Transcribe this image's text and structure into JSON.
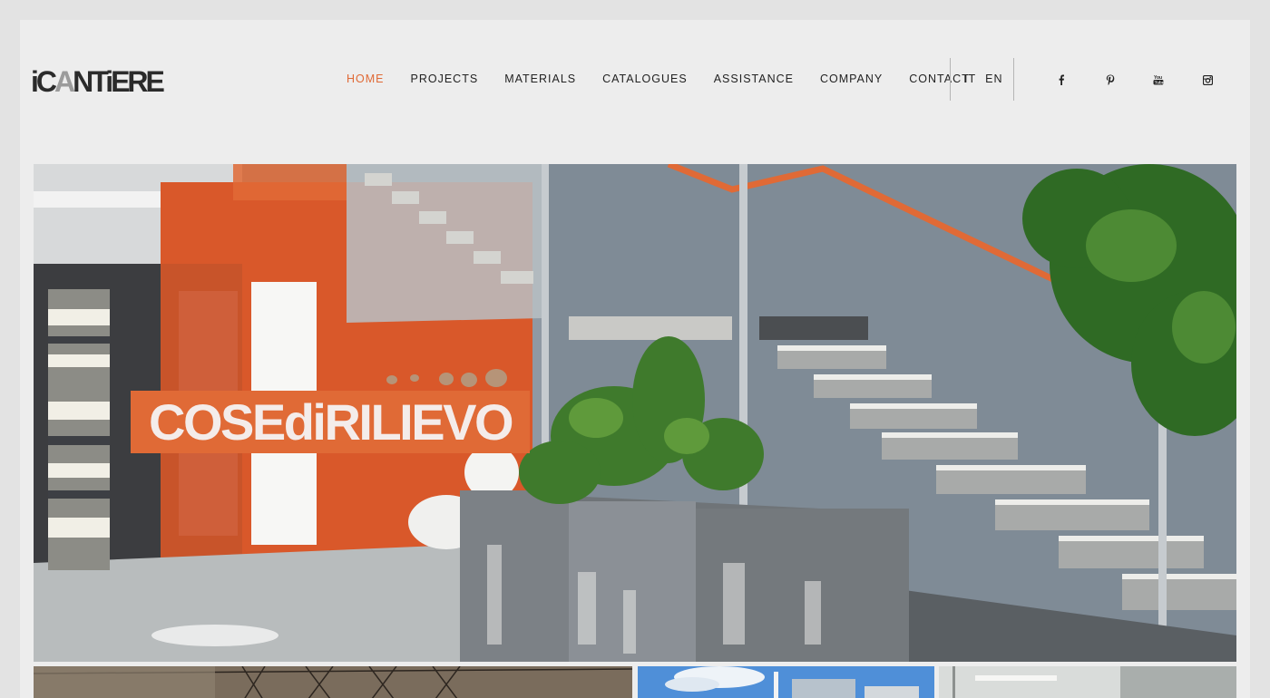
{
  "logo": {
    "part1": "iC",
    "part2": "A",
    "part3": "NTiERE"
  },
  "nav": {
    "items": [
      {
        "label": "HOME",
        "active": true
      },
      {
        "label": "PROJECTS",
        "active": false
      },
      {
        "label": "MATERIALS",
        "active": false
      },
      {
        "label": "CATALOGUES",
        "active": false
      },
      {
        "label": "ASSISTANCE",
        "active": false
      },
      {
        "label": "COMPANY",
        "active": false
      },
      {
        "label": "CONTACT",
        "active": false
      }
    ]
  },
  "languages": [
    "IT",
    "EN"
  ],
  "social": [
    "facebook-icon",
    "pinterest-icon",
    "youtube-icon",
    "instagram-icon"
  ],
  "social_glyphs": [
    "f",
    "p",
    "▶",
    "◙"
  ],
  "hero": {
    "banner_text": "COSEdiRILIEVO"
  },
  "colors": {
    "accent": "#e06a36",
    "page_bg": "#ededed",
    "outer_bg": "#e3e3e3",
    "text": "#222222"
  }
}
